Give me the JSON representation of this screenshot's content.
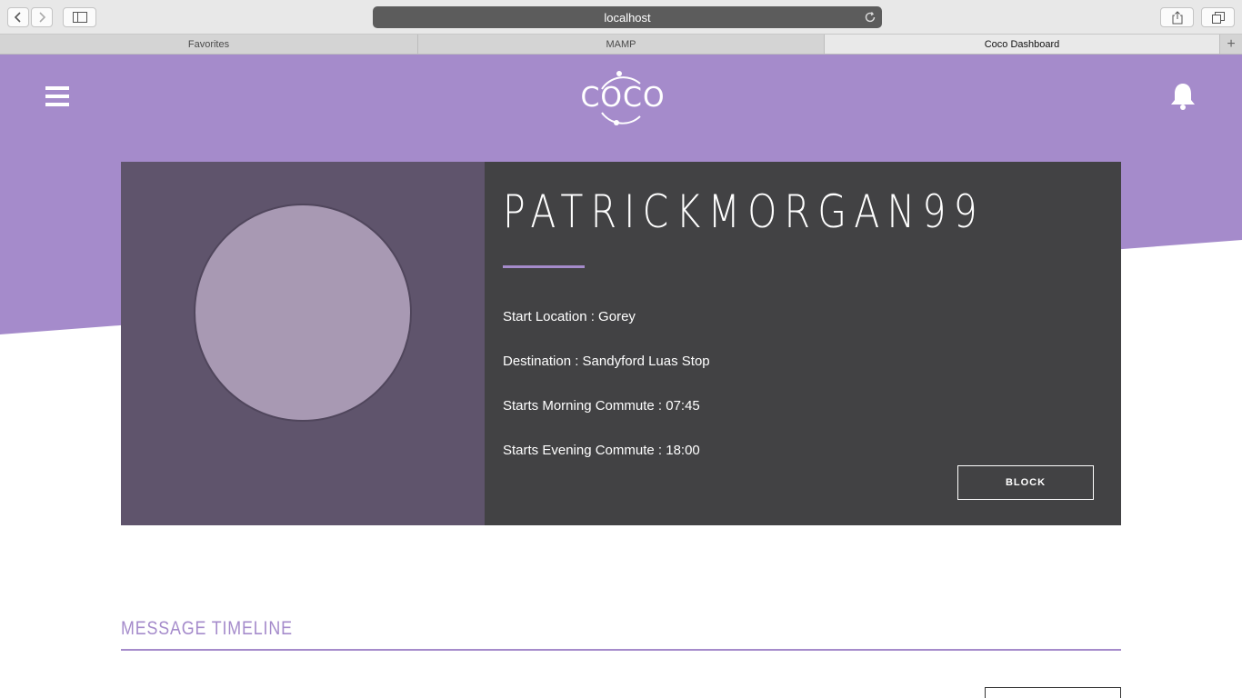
{
  "browser": {
    "url": "localhost",
    "tabs": [
      {
        "label": "Favorites"
      },
      {
        "label": "MAMP"
      },
      {
        "label": "Coco Dashboard"
      }
    ],
    "new_tab": "+"
  },
  "header": {
    "logo_text": "COCO"
  },
  "profile": {
    "username": "PATRICKMORGAN99",
    "start_location": "Start Location : Gorey",
    "destination": "Destination : Sandyford Luas Stop",
    "morning_commute": "Starts Morning Commute : 07:45",
    "evening_commute": "Starts Evening Commute : 18:00",
    "block_label": "BLOCK"
  },
  "timeline": {
    "title": "MESSAGE TIMELINE"
  },
  "colors": {
    "brand_purple": "#a58bcb",
    "card_dark": "#424244",
    "avatar_panel": "#5f546c",
    "avatar_fill": "#a899b3"
  },
  "icons": [
    "back-icon",
    "forward-icon",
    "sidebar-icon",
    "reload-icon",
    "share-icon",
    "tabs-icon",
    "menu-icon",
    "bell-icon"
  ]
}
